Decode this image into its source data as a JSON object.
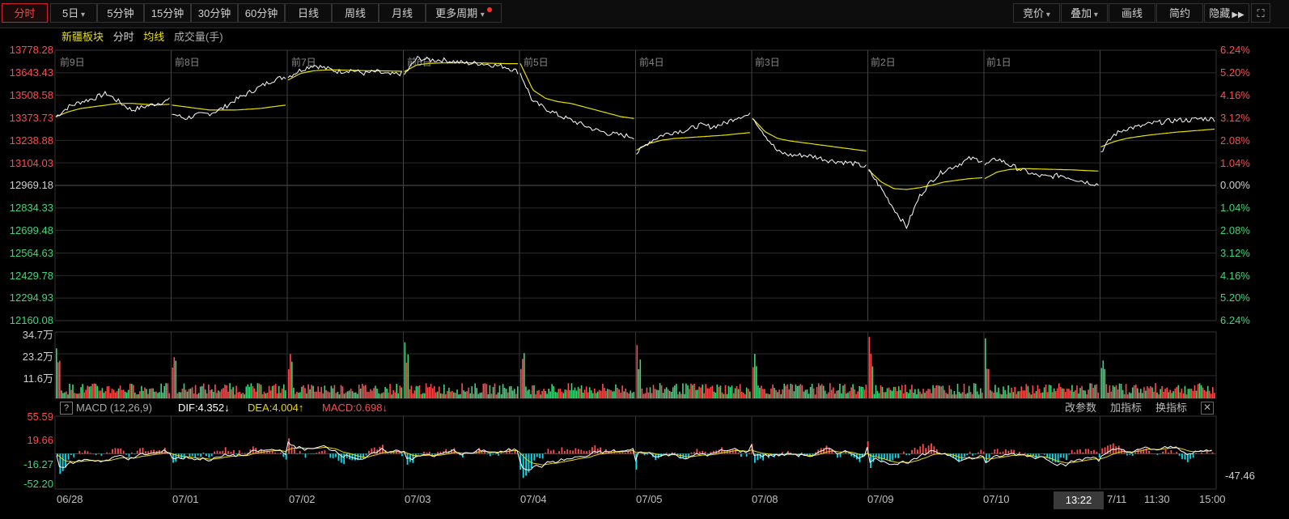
{
  "toolbar": {
    "left": [
      "分时",
      "5日",
      "5分钟",
      "15分钟",
      "30分钟",
      "60分钟",
      "日线",
      "周线",
      "月线",
      "更多周期"
    ],
    "right": [
      "竞价",
      "叠加",
      "画线",
      "简约",
      "隐藏"
    ]
  },
  "legend": {
    "name": "新疆板块",
    "mode": "分时",
    "avg": "均线",
    "vol": "成交量(手)"
  },
  "colors": {
    "up": "#ff4b4b",
    "down": "#3fd67a",
    "price": "#ffffff",
    "avg": "#e8e000",
    "grid": "#2a2a2a",
    "dif": "#ffffff",
    "dea": "#e8d800",
    "macd_up": "#ff4b4b",
    "macd_down": "#00e0f0"
  },
  "price_axis_left": [
    "13778.28",
    "13643.43",
    "13508.58",
    "13373.73",
    "13238.88",
    "13104.03",
    "12969.18",
    "12834.33",
    "12699.48",
    "12564.63",
    "12429.78",
    "12294.93",
    "12160.08"
  ],
  "price_axis_right": [
    "6.24%",
    "5.20%",
    "4.16%",
    "3.12%",
    "2.08%",
    "1.04%",
    "0.00%",
    "1.04%",
    "2.08%",
    "3.12%",
    "4.16%",
    "5.20%",
    "6.24%"
  ],
  "day_labels": [
    "前9日",
    "前8日",
    "前7日",
    "前6日",
    "前5日",
    "前4日",
    "前3日",
    "前2日",
    "前1日"
  ],
  "vol_axis": [
    "34.7万",
    "23.2万",
    "11.6万"
  ],
  "macd": {
    "title": "MACD (12,26,9)",
    "dif": "DIF:4.352↓",
    "dea": "DEA:4.004↑",
    "macd": "MACD:0.698↓",
    "tools": [
      "改参数",
      "加指标",
      "换指标"
    ],
    "axis": [
      "55.59",
      "19.66",
      "-16.27",
      "-52.20"
    ],
    "right_value": "-47.46"
  },
  "dates": [
    "06/28",
    "07/01",
    "07/02",
    "07/03",
    "07/04",
    "07/05",
    "07/08",
    "07/09",
    "07/10",
    "7/11",
    "11:30",
    "15:00"
  ],
  "crosshair_time": "13:22",
  "chart_data": {
    "type": "line",
    "title": "新疆板块",
    "base_value": 12969.18,
    "ylim": [
      12160.08,
      13778.28
    ],
    "days": [
      "06/28",
      "07/01",
      "07/02",
      "07/03",
      "07/04",
      "07/05",
      "07/08",
      "07/09",
      "07/10",
      "07/11"
    ],
    "series": [
      {
        "name": "分时",
        "day_close_points": [
          [
            13380,
            13440,
            13470,
            13490,
            13520,
            13470,
            13420,
            13440,
            13460,
            13480
          ],
          [
            13400,
            13370,
            13390,
            13400,
            13430,
            13480,
            13520,
            13560,
            13600,
            13620
          ],
          [
            13620,
            13660,
            13690,
            13670,
            13650,
            13660,
            13640,
            13650,
            13630,
            13640
          ],
          [
            13630,
            13730,
            13720,
            13720,
            13710,
            13700,
            13700,
            13690,
            13680,
            13650
          ],
          [
            13640,
            13470,
            13430,
            13390,
            13360,
            13330,
            13300,
            13280,
            13270,
            13260
          ],
          [
            13160,
            13230,
            13270,
            13290,
            13300,
            13330,
            13320,
            13340,
            13380,
            13390
          ],
          [
            13380,
            13270,
            13170,
            13150,
            13150,
            13140,
            13120,
            13110,
            13100,
            13080
          ],
          [
            13060,
            12950,
            12830,
            12720,
            12900,
            13000,
            13060,
            13090,
            13130,
            13120
          ],
          [
            13090,
            13130,
            13090,
            13060,
            13030,
            13020,
            13030,
            13010,
            12990,
            12975
          ],
          [
            13170,
            13270,
            13310,
            13320,
            13340,
            13350,
            13360,
            13360,
            13370,
            13365
          ]
        ]
      },
      {
        "name": "均线",
        "day_close_points": [
          [
            13380,
            13410,
            13430,
            13440,
            13450,
            13460,
            13460,
            13455,
            13450,
            13455
          ],
          [
            13450,
            13440,
            13430,
            13420,
            13420,
            13420,
            13425,
            13430,
            13440,
            13450
          ],
          [
            13600,
            13640,
            13655,
            13660,
            13660,
            13658,
            13656,
            13655,
            13654,
            13652
          ],
          [
            13650,
            13690,
            13700,
            13702,
            13703,
            13703,
            13702,
            13700,
            13698,
            13698
          ],
          [
            13700,
            13540,
            13490,
            13470,
            13460,
            13440,
            13420,
            13400,
            13380,
            13370
          ],
          [
            13180,
            13220,
            13240,
            13250,
            13255,
            13260,
            13265,
            13270,
            13278,
            13285
          ],
          [
            13370,
            13290,
            13250,
            13235,
            13225,
            13215,
            13205,
            13195,
            13185,
            13175
          ],
          [
            13060,
            12990,
            12950,
            12945,
            12955,
            12970,
            12990,
            13000,
            13010,
            13015
          ],
          [
            13010,
            13050,
            13065,
            13070,
            13068,
            13066,
            13064,
            13062,
            13058,
            13055
          ],
          [
            13200,
            13230,
            13250,
            13262,
            13272,
            13280,
            13288,
            13294,
            13300,
            13306
          ]
        ]
      }
    ],
    "volume_ylim": [
      0,
      347000
    ],
    "macd_ylim": [
      -52.2,
      55.59
    ]
  }
}
